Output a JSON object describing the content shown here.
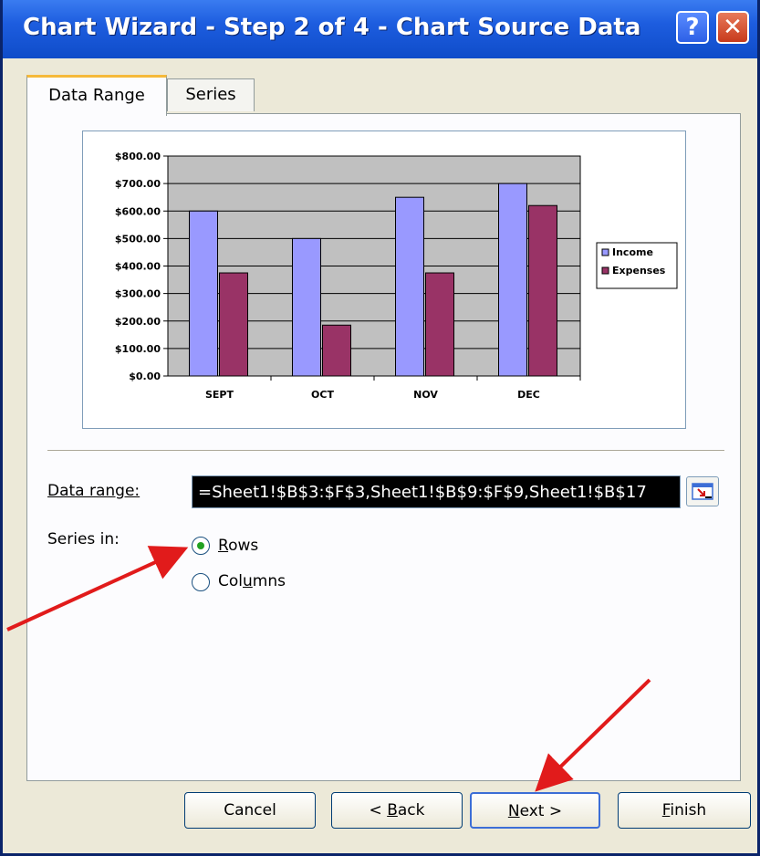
{
  "window": {
    "title": "Chart Wizard - Step 2 of 4 - Chart Source Data",
    "help_glyph": "?",
    "close_glyph": "✕"
  },
  "tabs": [
    {
      "label": "Data Range",
      "active": true
    },
    {
      "label": "Series",
      "active": false
    }
  ],
  "form": {
    "data_range_label": "Data range:",
    "data_range_value": "=Sheet1!$B$3:$F$3,Sheet1!$B$9:$F$9,Sheet1!$B$17",
    "series_in_label": "Series in:",
    "options": [
      {
        "label": "Rows",
        "selected": true
      },
      {
        "label": "Columns",
        "selected": false
      }
    ]
  },
  "buttons": {
    "cancel": "Cancel",
    "back": "< Back",
    "next": "Next >",
    "finish": "Finish"
  },
  "colors": {
    "income": "#9999ff",
    "expenses": "#993366",
    "plot_bg": "#c0c0c0",
    "annotation_arrow": "#e11b1b"
  },
  "chart_data": {
    "type": "bar",
    "categories": [
      "SEPT",
      "OCT",
      "NOV",
      "DEC"
    ],
    "series": [
      {
        "name": "Income",
        "values": [
          600,
          500,
          650,
          700
        ]
      },
      {
        "name": "Expenses",
        "values": [
          375,
          185,
          375,
          620
        ]
      }
    ],
    "ylim": [
      0,
      800
    ],
    "yticks": [
      "$0.00",
      "$100.00",
      "$200.00",
      "$300.00",
      "$400.00",
      "$500.00",
      "$600.00",
      "$700.00",
      "$800.00"
    ],
    "grid": true,
    "legend": "right"
  }
}
